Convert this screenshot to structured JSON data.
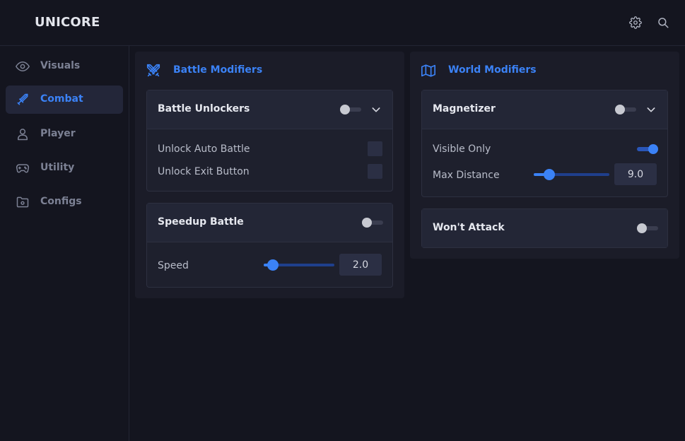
{
  "app": {
    "title": "UNICORE"
  },
  "header": {
    "icons": [
      "gear-icon",
      "search-icon"
    ]
  },
  "sidebar": {
    "items": [
      {
        "label": "Visuals",
        "icon": "eye-icon",
        "active": false
      },
      {
        "label": "Combat",
        "icon": "sword-icon",
        "active": true
      },
      {
        "label": "Player",
        "icon": "user-icon",
        "active": false
      },
      {
        "label": "Utility",
        "icon": "gamepad-icon",
        "active": false
      },
      {
        "label": "Configs",
        "icon": "folder-gear-icon",
        "active": false
      }
    ]
  },
  "battle_modifiers": {
    "title": "Battle Modifiers",
    "icon": "crossed-swords-icon",
    "battle_unlockers": {
      "title": "Battle Unlockers",
      "enabled": false,
      "expanded": true,
      "options": [
        {
          "label": "Unlock Auto Battle",
          "checked": false
        },
        {
          "label": "Unlock Exit Button",
          "checked": false
        }
      ]
    },
    "speedup_battle": {
      "title": "Speedup Battle",
      "enabled": false,
      "speed_label": "Speed",
      "speed_value": "2.0",
      "speed_fraction": 0.13
    }
  },
  "world_modifiers": {
    "title": "World Modifiers",
    "icon": "map-icon",
    "magnetizer": {
      "title": "Magnetizer",
      "enabled": false,
      "expanded": true,
      "visible_only_label": "Visible Only",
      "visible_only": true,
      "max_distance_label": "Max Distance",
      "max_distance_value": "9.0",
      "max_distance_fraction": 0.21
    },
    "wont_attack": {
      "title": "Won't Attack",
      "enabled": false
    }
  },
  "colors": {
    "accent": "#3b82f6",
    "background": "#14151f",
    "panel": "#1b1c28",
    "card_header": "#232636"
  }
}
